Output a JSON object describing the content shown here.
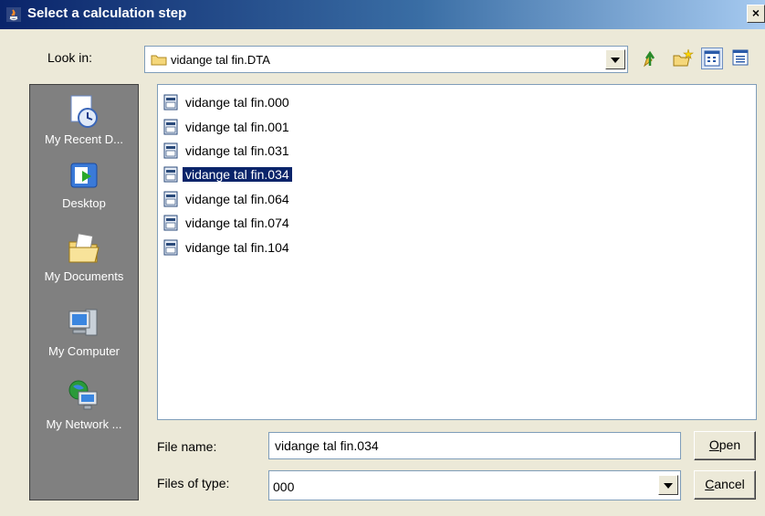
{
  "window": {
    "title": "Select a calculation step",
    "close_label": "×"
  },
  "lookin": {
    "label": "Look in:",
    "value": "vidange tal fin.DTA"
  },
  "toolbar": {
    "icons": [
      "up-folder-icon",
      "new-folder-icon",
      "list-view-icon",
      "details-view-icon"
    ]
  },
  "places": [
    {
      "label": "My Recent D...",
      "icon": "recent-documents-icon"
    },
    {
      "label": "Desktop",
      "icon": "desktop-icon"
    },
    {
      "label": "My Documents",
      "icon": "my-documents-icon"
    },
    {
      "label": "My Computer",
      "icon": "my-computer-icon"
    },
    {
      "label": "My Network ...",
      "icon": "my-network-icon"
    }
  ],
  "files": [
    {
      "name": "vidange tal fin.000",
      "selected": false
    },
    {
      "name": "vidange tal fin.001",
      "selected": false
    },
    {
      "name": "vidange tal fin.031",
      "selected": false
    },
    {
      "name": "vidange tal fin.034",
      "selected": true
    },
    {
      "name": "vidange tal fin.064",
      "selected": false
    },
    {
      "name": "vidange tal fin.074",
      "selected": false
    },
    {
      "name": "vidange tal fin.104",
      "selected": false
    }
  ],
  "filename": {
    "label": "File name:",
    "value": "vidange tal fin.034"
  },
  "filetype": {
    "label": "Files of type:",
    "value": "000"
  },
  "buttons": {
    "open_label": {
      "mnemonic": "O",
      "rest": "pen"
    },
    "cancel_label": {
      "mnemonic": "C",
      "rest": "ancel"
    }
  }
}
